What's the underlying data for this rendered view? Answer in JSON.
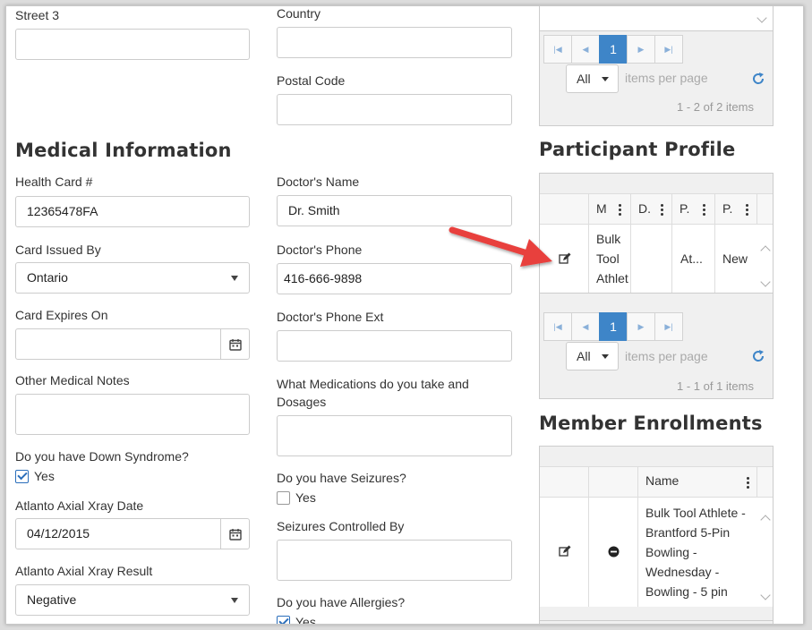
{
  "address": {
    "street3_label": "Street 3",
    "street3_value": "",
    "country_label": "Country",
    "country_value": "",
    "postal_label": "Postal Code",
    "postal_value": ""
  },
  "medical": {
    "title": "Medical Information",
    "health_card_label": "Health Card #",
    "health_card_value": "12365478FA",
    "card_issued_label": "Card Issued By",
    "card_issued_value": "Ontario",
    "card_expires_label": "Card Expires On",
    "card_expires_value": "",
    "other_notes_label": "Other Medical Notes",
    "other_notes_value": "",
    "down_syndrome_label": "Do you have Down Syndrome?",
    "down_syndrome_option": "Yes",
    "down_syndrome_checked": true,
    "xray_date_label": "Atlanto Axial Xray Date",
    "xray_date_value": "04/12/2015",
    "xray_result_label": "Atlanto Axial Xray Result",
    "xray_result_value": "Negative",
    "doctor_name_label": "Doctor's Name",
    "doctor_name_value": "Dr. Smith",
    "doctor_phone_label": "Doctor's Phone",
    "doctor_phone_value": "416-666-9898",
    "doctor_ext_label": "Doctor's Phone Ext",
    "doctor_ext_value": "",
    "medications_label_line1": "What Medications do you take and",
    "medications_label_line2": "Dosages",
    "medications_value": "",
    "seizures_label": "Do you have Seizures?",
    "seizures_option": "Yes",
    "seizures_checked": false,
    "seizures_controlled_label": "Seizures Controlled By",
    "seizures_controlled_value": "",
    "allergies_label": "Do you have Allergies?",
    "allergies_option": "Yes",
    "allergies_checked": true
  },
  "top_grid": {
    "page": "1",
    "page_size": "All",
    "items_per_page": "items per page",
    "count": "1 - 2 of 2 items"
  },
  "participant_profile": {
    "title": "Participant Profile",
    "columns": [
      "M",
      "D.",
      "P.",
      "P."
    ],
    "row": {
      "col1_lines": [
        "Bulk",
        "Tool",
        "Athlet"
      ],
      "col2": "",
      "col3": "At...",
      "col4": "New"
    },
    "page": "1",
    "page_size": "All",
    "items_per_page": "items per page",
    "count": "1 - 1 of 1 items"
  },
  "member_enrollments": {
    "title": "Member Enrollments",
    "columns": [
      "Name"
    ],
    "row_lines": [
      "Bulk Tool Athlete -",
      "Brantford 5-Pin",
      "Bowling -",
      "Wednesday -",
      "Bowling - 5 pin"
    ]
  },
  "icons": {
    "edit": "edit-icon",
    "remove": "minus-circle-icon",
    "calendar": "calendar-icon",
    "refresh": "refresh-icon",
    "annotation": "red-arrow-annotation"
  },
  "colors": {
    "accent": "#3e85c8",
    "arrow": "#e8403e",
    "check": "#2a6ebb"
  }
}
